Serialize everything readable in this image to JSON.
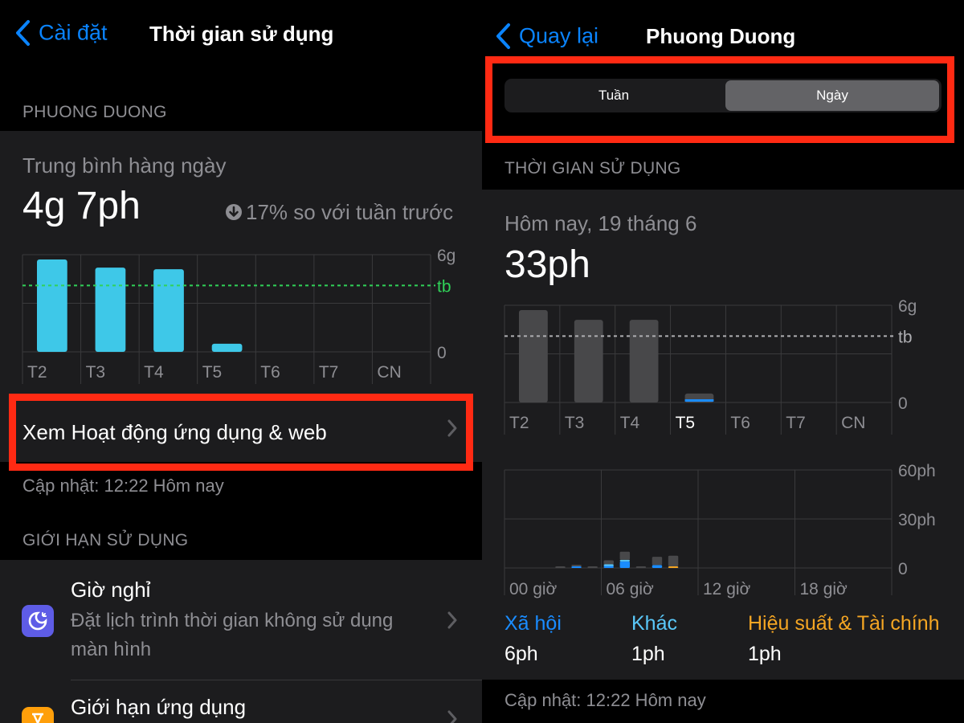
{
  "left": {
    "nav": {
      "back_label": "Cài đặt",
      "title": "Thời gian sử dụng"
    },
    "user_section": "PHUONG DUONG",
    "daily_avg_label": "Trung bình hàng ngày",
    "daily_avg_value": "4g 7ph",
    "change_text": "17% so với tuần trước",
    "view_activity": "Xem Hoạt động ứng dụng & web",
    "updated": "Cập nhật: 12:22 Hôm nay",
    "limits_section": "GIỚI HẠN SỬ DỤNG",
    "downtime": {
      "title": "Giờ nghỉ",
      "subtitle_line1": "Đặt lịch trình thời gian không sử dụng",
      "subtitle_line2": "màn hình"
    },
    "app_limits": {
      "title": "Giới hạn ứng dụng"
    }
  },
  "right": {
    "nav": {
      "back_label": "Quay lại",
      "title": "Phuong Duong"
    },
    "segments": [
      "Tuần",
      "Ngày"
    ],
    "selected_segment": "Ngày",
    "section": "THỜI GIAN SỬ DỤNG",
    "date_label": "Hôm nay, 19 tháng 6",
    "total": "33ph",
    "categories": [
      {
        "name": "Xã hội",
        "value": "6ph",
        "color": "#1a8cff"
      },
      {
        "name": "Khác",
        "value": "1ph",
        "color": "#5ac8fa"
      },
      {
        "name": "Hiệu suất & Tài chính",
        "value": "1ph",
        "color": "#f5a623"
      }
    ],
    "updated": "Cập nhật: 12:22 Hôm nay"
  },
  "chart_data": [
    {
      "type": "bar",
      "categories": [
        "T2",
        "T3",
        "T4",
        "T5",
        "T6",
        "T7",
        "CN"
      ],
      "values": [
        5.7,
        5.2,
        5.1,
        0.5,
        0,
        0,
        0
      ],
      "ylim": [
        0,
        6
      ],
      "yticks": [
        "0",
        "6g"
      ],
      "average_line_label": "tb",
      "average_value": 4.1,
      "color": "#3ec8e8"
    },
    {
      "type": "bar",
      "categories": [
        "T2",
        "T3",
        "T4",
        "T5",
        "T6",
        "T7",
        "CN"
      ],
      "values": [
        5.7,
        5.1,
        5.1,
        0.55,
        0,
        0,
        0
      ],
      "ylim": [
        0,
        6
      ],
      "yticks": [
        "0",
        "6g"
      ],
      "average_line_label": "tb",
      "average_value": 4.1,
      "highlight_category": "T5"
    },
    {
      "type": "bar",
      "x_labels": [
        "00 giờ",
        "06 giờ",
        "12 giờ",
        "18 giờ"
      ],
      "yticks": [
        "0",
        "30ph",
        "60ph"
      ],
      "ylim": [
        0,
        60
      ],
      "hours": [
        0,
        1,
        2,
        3,
        4,
        5,
        6,
        7,
        8,
        9,
        10,
        11,
        12,
        13,
        14,
        15,
        16,
        17,
        18,
        19,
        20,
        21,
        22,
        23
      ],
      "series": [
        {
          "name": "Xã hội",
          "values": [
            0,
            0,
            0,
            0,
            0.8,
            0,
            1.2,
            4,
            0,
            1.8,
            0,
            0,
            0,
            0,
            0,
            0,
            0,
            0,
            0,
            0,
            0,
            0,
            0,
            0
          ]
        },
        {
          "name": "Khác",
          "values": [
            0,
            0,
            0,
            0,
            0,
            0,
            0.3,
            0.3,
            0,
            0,
            0,
            0,
            0,
            0,
            0,
            0,
            0,
            0,
            0,
            0,
            0,
            0,
            0,
            0
          ]
        },
        {
          "name": "Hiệu suất & Tài chính",
          "values": [
            0,
            0,
            0,
            0,
            0,
            0,
            0,
            0,
            0,
            0,
            1,
            0,
            0,
            0,
            0,
            0,
            0,
            0,
            0,
            0,
            0,
            0,
            0,
            0
          ]
        },
        {
          "values": [
            0,
            0,
            0,
            0.3,
            0.2,
            0.8,
            2.5,
            5,
            0.6,
            5,
            6.5,
            0,
            0,
            0,
            0,
            0,
            0,
            0,
            0,
            0,
            0,
            0,
            0,
            0
          ]
        }
      ]
    }
  ]
}
